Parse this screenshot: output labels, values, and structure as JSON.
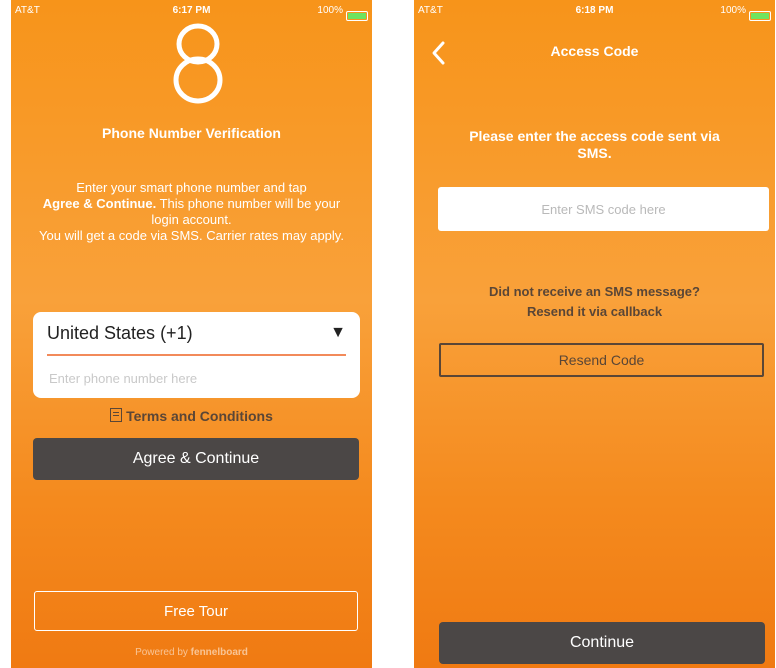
{
  "left_screen": {
    "status_bar": {
      "carrier": "AT&T",
      "time": "6:17 PM",
      "battery": "100%"
    },
    "logo_icon": "eight-logo-icon",
    "title": "Phone Number Verification",
    "instructions": {
      "line1": "Enter your smart phone number and tap",
      "agree_bold": "Agree & Continue.",
      "line2_rest": " This phone number will be your login account.",
      "line3": "You will get a code via SMS. Carrier rates may apply."
    },
    "country_select": {
      "value": "United States (+1)"
    },
    "phone_input": {
      "placeholder": "Enter phone number here",
      "value": ""
    },
    "terms_label": "Terms and Conditions",
    "agree_button_label": "Agree & Continue",
    "free_tour_label": "Free Tour",
    "powered_by": {
      "prefix": "Powered by",
      "brand": "fennelboard"
    }
  },
  "right_screen": {
    "status_bar": {
      "carrier": "AT&T",
      "time": "6:18 PM",
      "battery": "100%"
    },
    "title": "Access Code",
    "prompt": "Please enter the access code sent via SMS.",
    "sms_input": {
      "placeholder": "Enter SMS code here",
      "value": ""
    },
    "not_received": "Did not receive an SMS message?",
    "callback_link": "Resend it via callback",
    "resend_button_label": "Resend Code",
    "continue_button_label": "Continue"
  },
  "colors": {
    "orange_top": "#f7941a",
    "orange_bottom": "#f07a12",
    "dark_button": "#4b4746",
    "brown_text": "#5a4636",
    "underline": "#f28a5a"
  }
}
